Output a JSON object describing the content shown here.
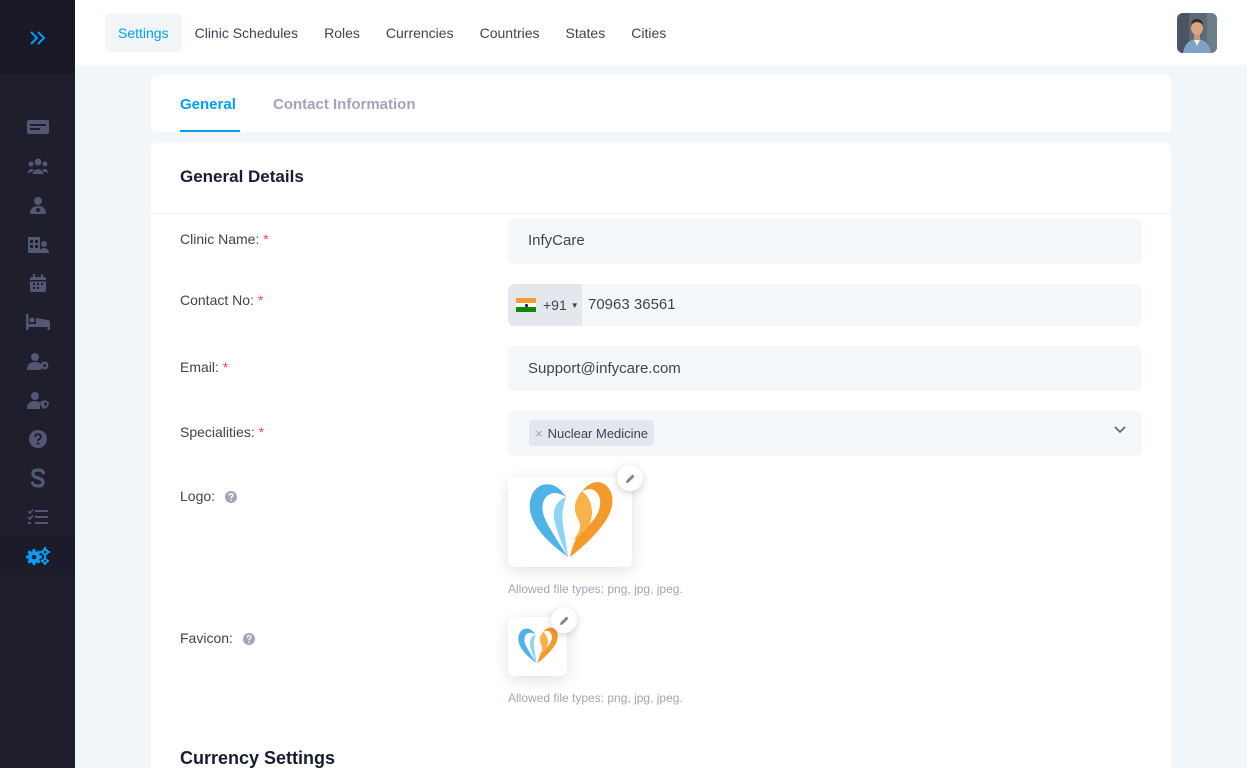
{
  "sidebar": {
    "toggle_icon": "double-chevron-right-icon",
    "items": [
      {
        "icon": "dashboard-icon"
      },
      {
        "icon": "users-icon"
      },
      {
        "icon": "doctor-icon"
      },
      {
        "icon": "clinic-building-icon"
      },
      {
        "icon": "calendar-icon"
      },
      {
        "icon": "bed-icon"
      },
      {
        "icon": "user-settings-icon"
      },
      {
        "icon": "user-shield-icon"
      },
      {
        "icon": "question-circle-icon"
      },
      {
        "icon": "dollar-s-icon"
      },
      {
        "icon": "task-list-icon"
      },
      {
        "icon": "settings-cogs-icon",
        "active": true
      }
    ]
  },
  "topbar": {
    "tabs": [
      "Settings",
      "Clinic Schedules",
      "Roles",
      "Currencies",
      "Countries",
      "States",
      "Cities"
    ],
    "active_tab": "Settings"
  },
  "subtabs": {
    "general": "General",
    "contact": "Contact Information"
  },
  "general_details": {
    "title": "General Details",
    "clinic_name_label": "Clinic Name:",
    "clinic_name_value": "InfyCare",
    "contact_label": "Contact No:",
    "contact_dial_code": "+91",
    "contact_value": "70963 36561",
    "email_label": "Email:",
    "email_value": "Support@infycare.com",
    "specialities_label": "Specialities:",
    "speciality_tag": "Nuclear Medicine",
    "required_mark": "*",
    "logo_label": "Logo:",
    "logo_hint": "Allowed file types: png, jpg, jpeg.",
    "favicon_label": "Favicon:",
    "favicon_hint": "Allowed file types: png, jpg, jpeg."
  },
  "currency_settings": {
    "title": "Currency Settings"
  },
  "colors": {
    "accent": "#009ef7",
    "sidebar_bg": "#1e1e2d",
    "required": "#f1416c",
    "logo_blue": "#4fb3e8",
    "logo_orange": "#f39a2b"
  }
}
